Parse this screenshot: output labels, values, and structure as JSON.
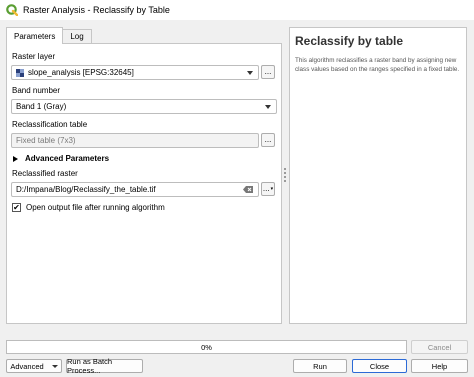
{
  "window": {
    "title": "Raster Analysis - Reclassify by Table"
  },
  "tabs": [
    {
      "label": "Parameters",
      "active": true
    },
    {
      "label": "Log",
      "active": false
    }
  ],
  "form": {
    "raster_layer_label": "Raster layer",
    "raster_layer_value": "slope_analysis [EPSG:32645]",
    "band_number_label": "Band number",
    "band_number_value": "Band 1 (Gray)",
    "reclass_table_label": "Reclassification table",
    "reclass_table_value": "Fixed table (7x3)",
    "advanced_params_label": "Advanced Parameters",
    "reclassified_raster_label": "Reclassified raster",
    "reclassified_raster_value": "D:/Impana/Blog/Reclassify_the_table.tif",
    "open_output_label": "Open output file after running algorithm",
    "open_output_checked": true,
    "browse_label": "..."
  },
  "help": {
    "title": "Reclassify by table",
    "description": "This algorithm reclassifies a raster band by assigning new class values based on the ranges specified in a fixed table."
  },
  "footer": {
    "progress_text": "0%",
    "progress_value": 0,
    "cancel_label": "Cancel",
    "advanced_label": "Advanced",
    "batch_label": "Run as Batch Process...",
    "run_label": "Run",
    "close_label": "Close",
    "help_label": "Help"
  },
  "colors": {
    "qgis_green": "#5a9e32",
    "qgis_yellow": "#efb933",
    "focus_blue": "#2c6ad6"
  }
}
